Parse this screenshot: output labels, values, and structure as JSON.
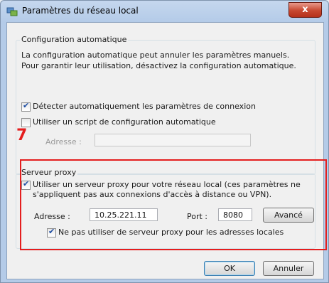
{
  "window": {
    "title": "Paramètres du réseau local",
    "close_label": "x"
  },
  "auto_config": {
    "legend": "Configuration automatique",
    "description": "La configuration automatique peut annuler les paramètres manuels. Pour garantir leur utilisation, désactivez la configuration automatique.",
    "detect_label": "Détecter automatiquement les paramètres de connexion",
    "detect_checked": true,
    "script_label": "Utiliser un script de configuration automatique",
    "script_checked": false,
    "address_label": "Adresse :",
    "address_value": ""
  },
  "annotation": {
    "step": "7",
    "color": "#e41e1e"
  },
  "proxy": {
    "legend": "Serveur proxy",
    "use_proxy_label_line1": "Utiliser un serveur proxy pour votre réseau local (ces paramètres ne",
    "use_proxy_label_line2": "s'appliquent pas aux connexions d'accès à distance ou VPN).",
    "use_proxy_checked": true,
    "address_label": "Adresse :",
    "address_value": "10.25.221.11",
    "port_label": "Port :",
    "port_value": "8080",
    "advanced_label": "Avancé",
    "bypass_label": "Ne pas utiliser de serveur proxy pour les adresses locales",
    "bypass_checked": true
  },
  "buttons": {
    "ok": "OK",
    "cancel": "Annuler"
  }
}
